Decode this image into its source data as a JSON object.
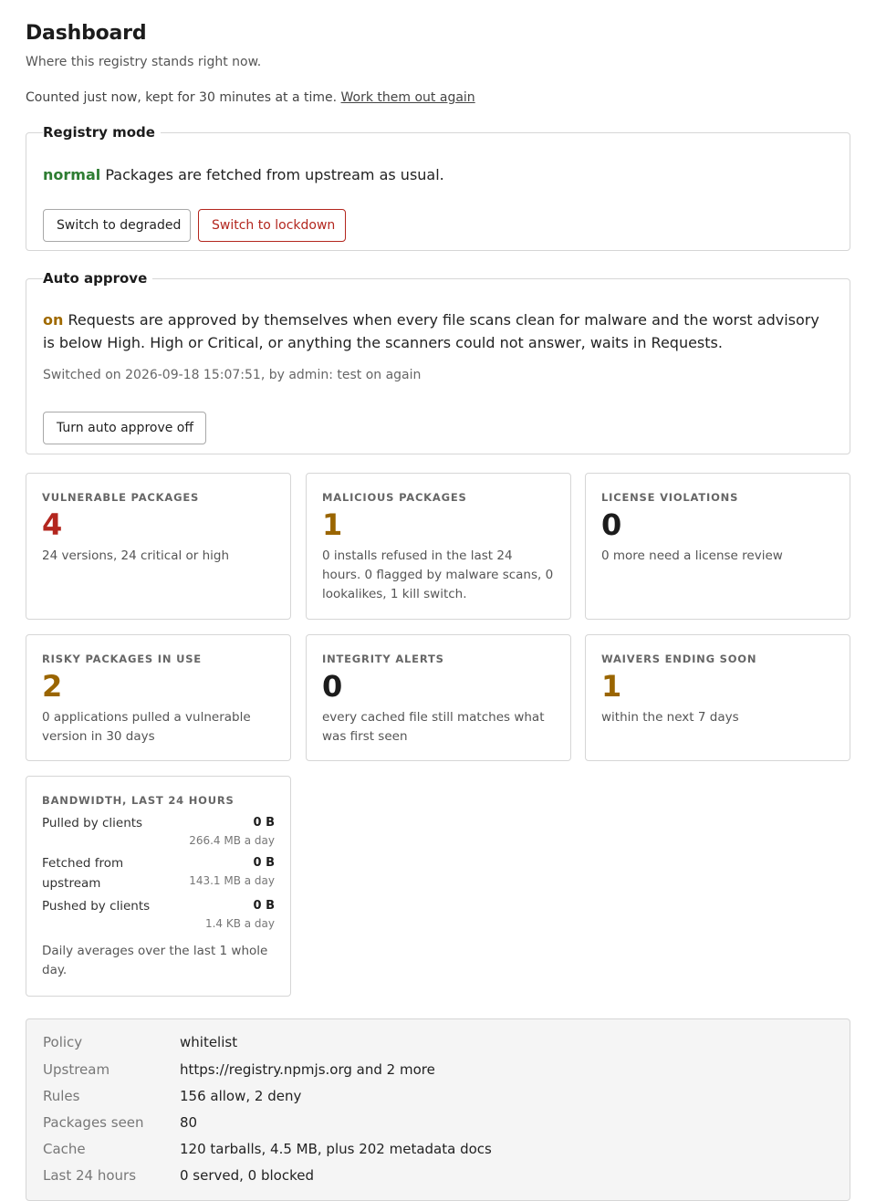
{
  "header": {
    "title": "Dashboard",
    "subtitle": "Where this registry stands right now.",
    "counted_text": "Counted just now, kept for 30 minutes at a time.",
    "recalc_link": "Work them out again"
  },
  "registry_mode": {
    "legend": "Registry mode",
    "state": "normal",
    "description": "Packages are fetched from upstream as usual.",
    "btn_degraded": "Switch to degraded",
    "btn_lockdown": "Switch to lockdown"
  },
  "auto_approve": {
    "legend": "Auto approve",
    "state": "on",
    "description": "Requests are approved by themselves when every file scans clean for malware and the worst advisory is below High. High or Critical, or anything the scanners could not answer, waits in Requests.",
    "switched": "Switched on 2026-09-18 15:07:51, by admin: test on again",
    "btn_off": "Turn auto approve off"
  },
  "cards": {
    "vulnerable": {
      "label": "Vulnerable packages",
      "value": "4",
      "desc": "24 versions, 24 critical or high"
    },
    "malicious": {
      "label": "Malicious packages",
      "value": "1",
      "desc": "0 installs refused in the last 24 hours. 0 flagged by malware scans, 0 lookalikes, 1 kill switch."
    },
    "license": {
      "label": "License violations",
      "value": "0",
      "desc": "0 more need a license review"
    },
    "risky": {
      "label": "Risky packages in use",
      "value": "2",
      "desc": "0 applications pulled a vulnerable version in 30 days"
    },
    "integrity": {
      "label": "Integrity alerts",
      "value": "0",
      "desc": "every cached file still matches what was first seen"
    },
    "waivers": {
      "label": "Waivers ending soon",
      "value": "1",
      "desc": "within the next 7 days"
    }
  },
  "bandwidth": {
    "label": "Bandwidth, last 24 hours",
    "rows": [
      {
        "name": "Pulled by clients",
        "value": "0 B",
        "avg": "266.4 MB a day"
      },
      {
        "name": "Fetched from upstream",
        "value": "0 B",
        "avg": "143.1 MB a day"
      },
      {
        "name": "Pushed by clients",
        "value": "0 B",
        "avg": "1.4 KB a day"
      }
    ],
    "note": "Daily averages over the last 1 whole day."
  },
  "summary": {
    "rows": [
      {
        "key": "Policy",
        "value": "whitelist"
      },
      {
        "key": "Upstream",
        "value": "https://registry.npmjs.org and 2 more"
      },
      {
        "key": "Rules",
        "value": "156 allow, 2 deny"
      },
      {
        "key": "Packages seen",
        "value": "80"
      },
      {
        "key": "Cache",
        "value": "120 tarballs, 4.5 MB, plus 202 metadata docs"
      },
      {
        "key": "Last 24 hours",
        "value": "0 served, 0 blocked"
      }
    ]
  },
  "colors": {
    "normal_state": "#2e7d32",
    "on_state": "#a06a00",
    "danger": "#b3261e",
    "warning_value": "#9a6500"
  }
}
